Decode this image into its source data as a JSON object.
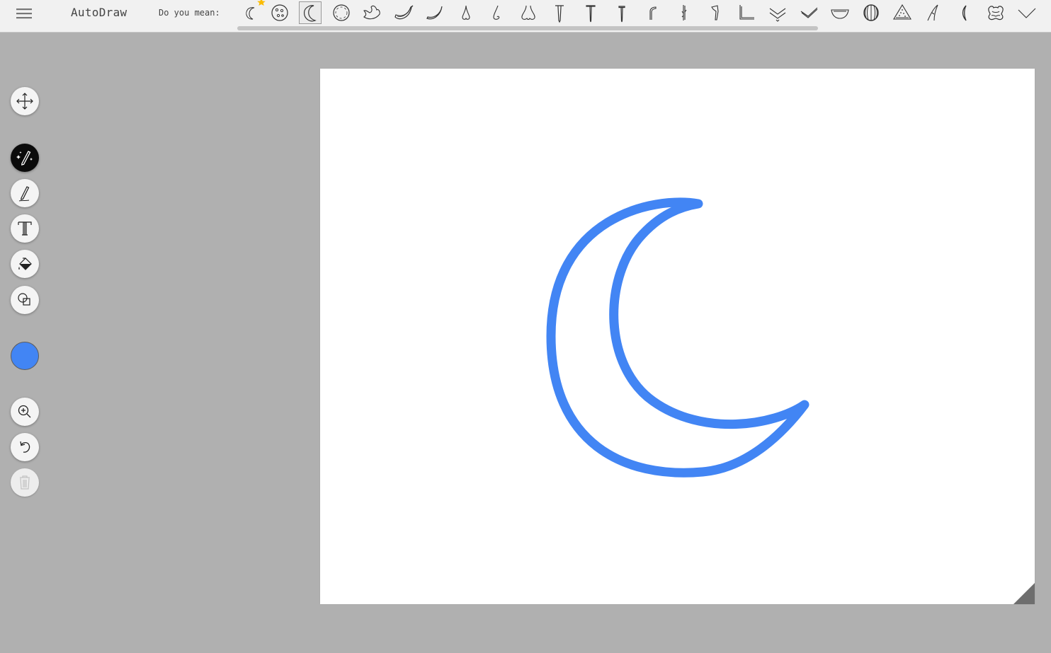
{
  "app": {
    "title": "AutoDraw"
  },
  "suggestions": {
    "label": "Do you mean:",
    "items": [
      {
        "name": "crescent-moon-small-icon"
      },
      {
        "name": "cookie-icon"
      },
      {
        "name": "crescent-moon-icon"
      },
      {
        "name": "pizza-circle-icon"
      },
      {
        "name": "bird-icon"
      },
      {
        "name": "banana-icon"
      },
      {
        "name": "banana-peel-icon"
      },
      {
        "name": "nose-icon"
      },
      {
        "name": "nose-profile-icon"
      },
      {
        "name": "nose-front-icon"
      },
      {
        "name": "nail-icon"
      },
      {
        "name": "nail-tall-icon"
      },
      {
        "name": "nail-thin-icon"
      },
      {
        "name": "faucet-icon"
      },
      {
        "name": "reed-icon"
      },
      {
        "name": "leg-icon"
      },
      {
        "name": "angle-corner-icon"
      },
      {
        "name": "double-check-icon"
      },
      {
        "name": "check-mark-icon"
      },
      {
        "name": "bowl-icon"
      },
      {
        "name": "watermelon-icon"
      },
      {
        "name": "watermelon-slice-icon"
      },
      {
        "name": "blade-icon"
      },
      {
        "name": "parenthesis-icon"
      },
      {
        "name": "frog-icon"
      },
      {
        "name": "check-thin-icon"
      }
    ]
  },
  "tools": {
    "move": "move-icon",
    "autodraw": "autodraw-icon",
    "draw": "pencil-icon",
    "type": "text-icon",
    "fill": "fill-bucket-icon",
    "shape": "shape-icon",
    "zoom": "zoom-in-icon",
    "undo": "undo-icon",
    "delete": "trash-icon"
  },
  "active_tool": "autodraw",
  "colors": {
    "current": "#4285f4",
    "stroke": "#4285f4",
    "star": "#fbbc04"
  }
}
